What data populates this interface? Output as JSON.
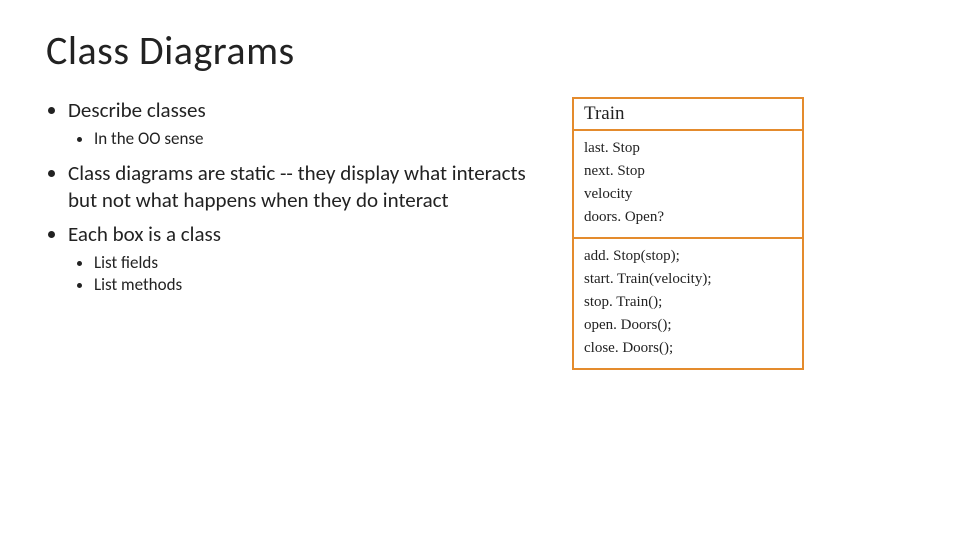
{
  "title": "Class Diagrams",
  "bullets": {
    "b1": "Describe classes",
    "b1a": "In the OO sense",
    "b2": "Class diagrams are static -- they display what interacts but not what happens when they do interact",
    "b3": "Each box is a class",
    "b3a": "List fields",
    "b3b": "List methods"
  },
  "uml": {
    "className": "Train",
    "fields": {
      "f1": "last. Stop",
      "f2": "next. Stop",
      "f3": "velocity",
      "f4": "doors. Open?"
    },
    "methods": {
      "m1": "add. Stop(stop);",
      "m2": "start. Train(velocity);",
      "m3": "stop. Train();",
      "m4": "open. Doors();",
      "m5": "close. Doors();"
    }
  }
}
